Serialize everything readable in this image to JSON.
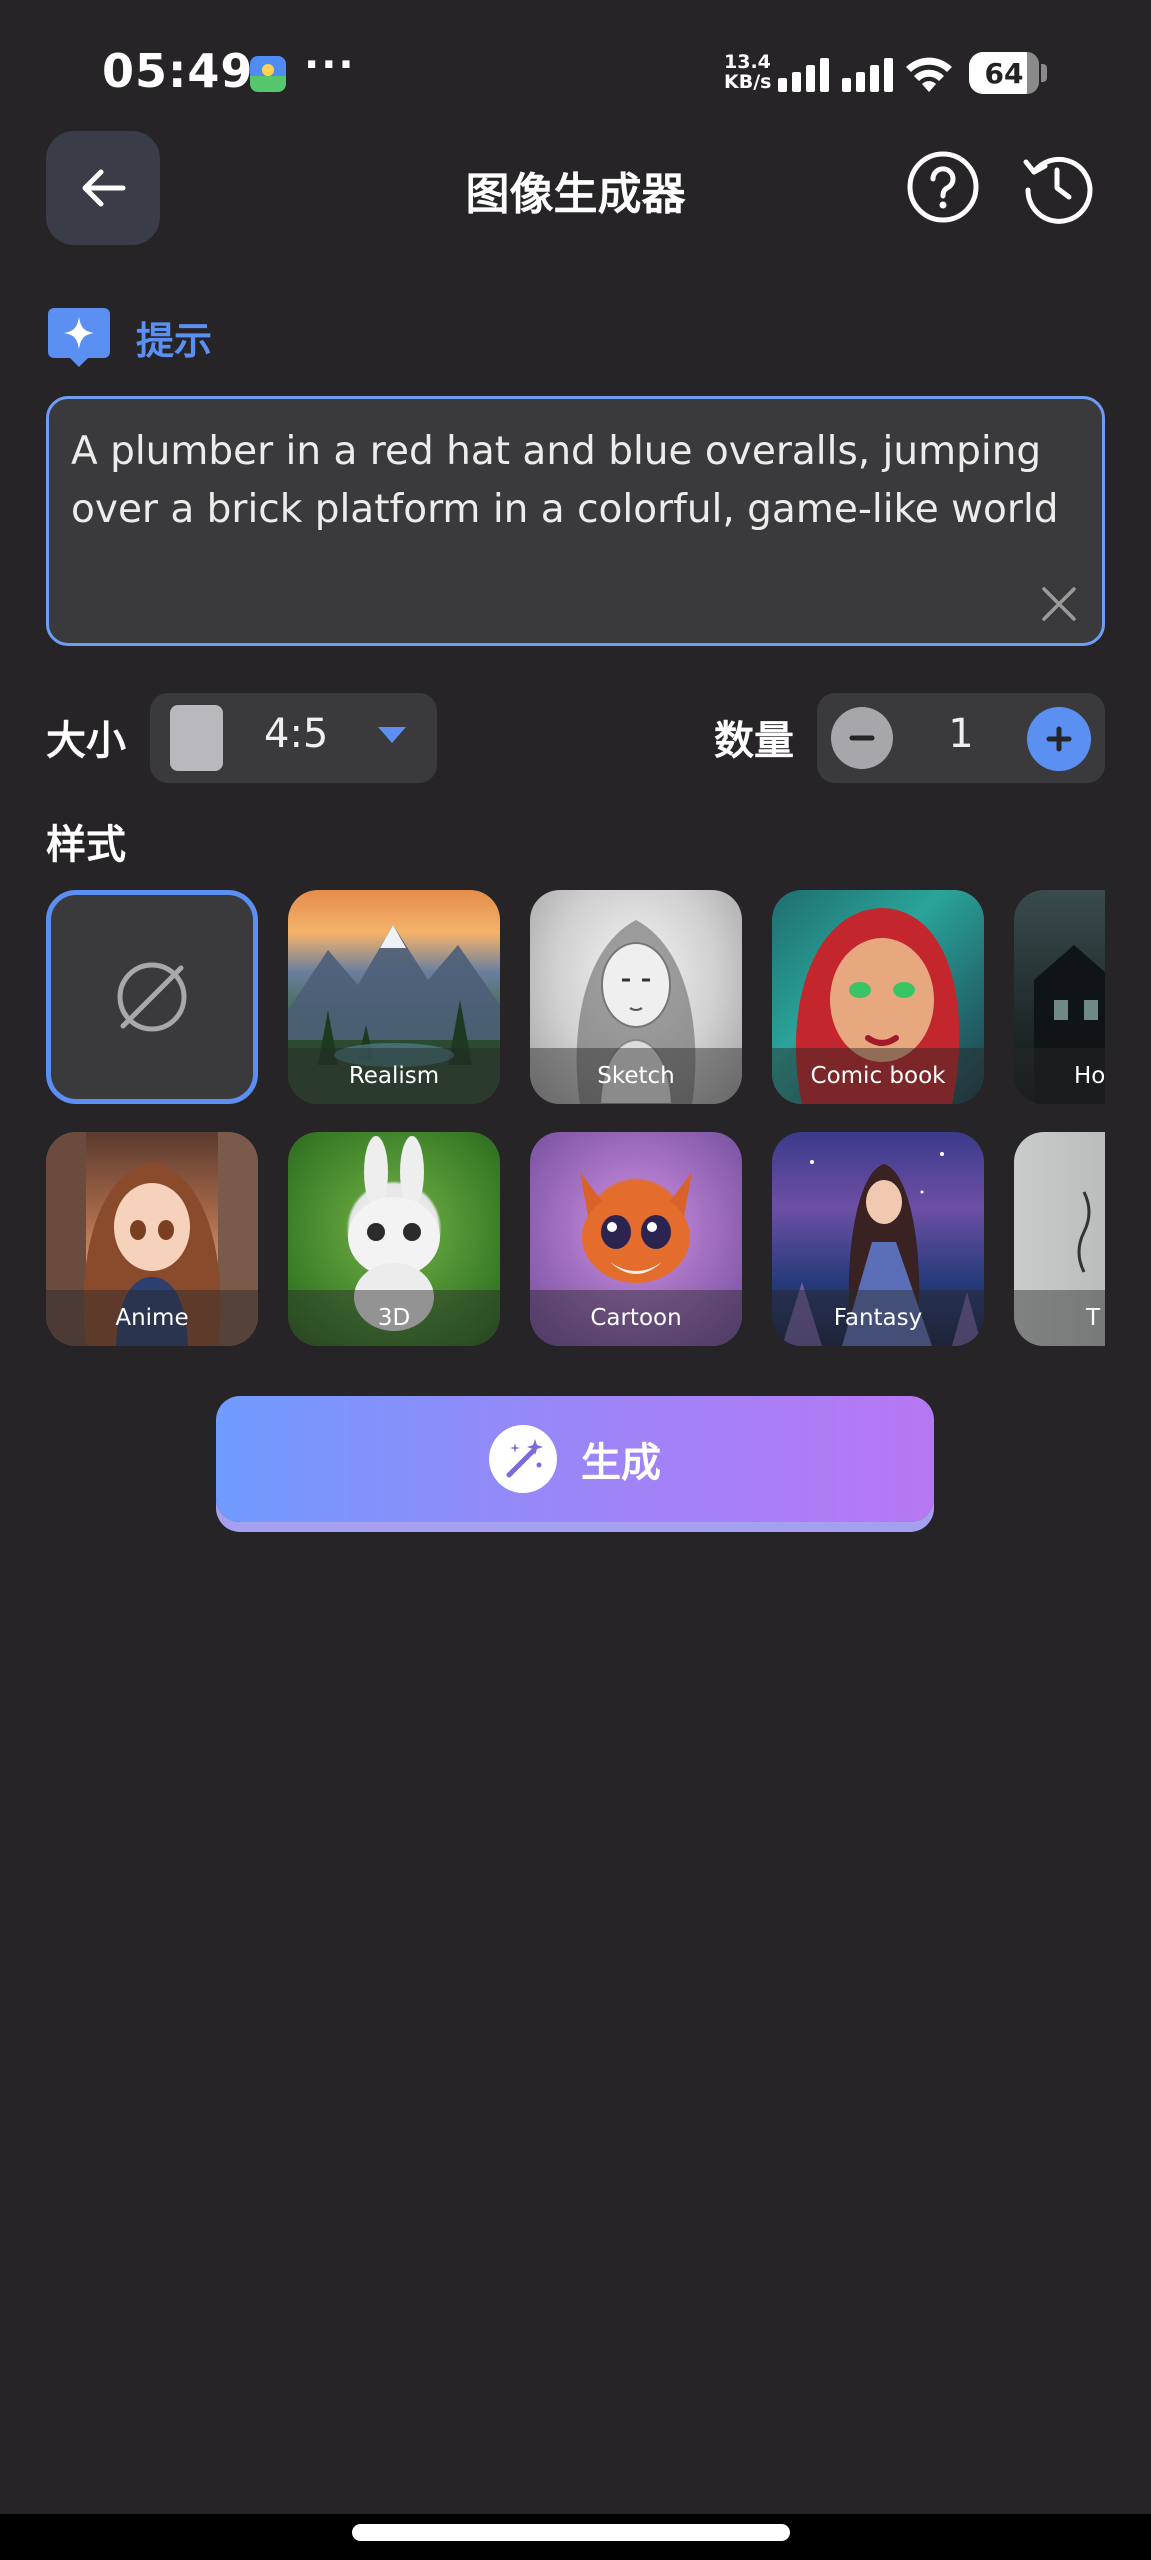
{
  "status_bar": {
    "time": "05:49",
    "more": "···",
    "net_speed_value": "13.4",
    "net_speed_unit": "KB/s",
    "battery": "64"
  },
  "header": {
    "title": "图像生成器"
  },
  "prompt": {
    "label": "提示",
    "text": "A plumber in a red hat and blue overalls, jumping over a brick platform in a colorful, game-like world"
  },
  "size": {
    "label": "大小",
    "value": "4:5"
  },
  "quantity": {
    "label": "数量",
    "value": "1"
  },
  "styles": {
    "label": "样式",
    "items": [
      {
        "label": "Realism"
      },
      {
        "label": "Sketch"
      },
      {
        "label": "Comic book"
      },
      {
        "label": "Ho"
      },
      {
        "label": "Anime"
      },
      {
        "label": "3D"
      },
      {
        "label": "Cartoon"
      },
      {
        "label": "Fantasy"
      },
      {
        "label": "T"
      }
    ]
  },
  "generate": {
    "label": "生成"
  },
  "colors": {
    "accent": "#5b8ff2",
    "background": "#262426",
    "surface": "#3a3a3d",
    "gradient_start": "#6f9bff",
    "gradient_end": "#b777f3"
  },
  "icons": [
    "back-arrow-icon",
    "help-icon",
    "history-icon",
    "sparkle-icon",
    "close-icon",
    "chevron-down-icon",
    "minus-icon",
    "plus-icon",
    "no-style-icon",
    "magic-wand-icon"
  ]
}
